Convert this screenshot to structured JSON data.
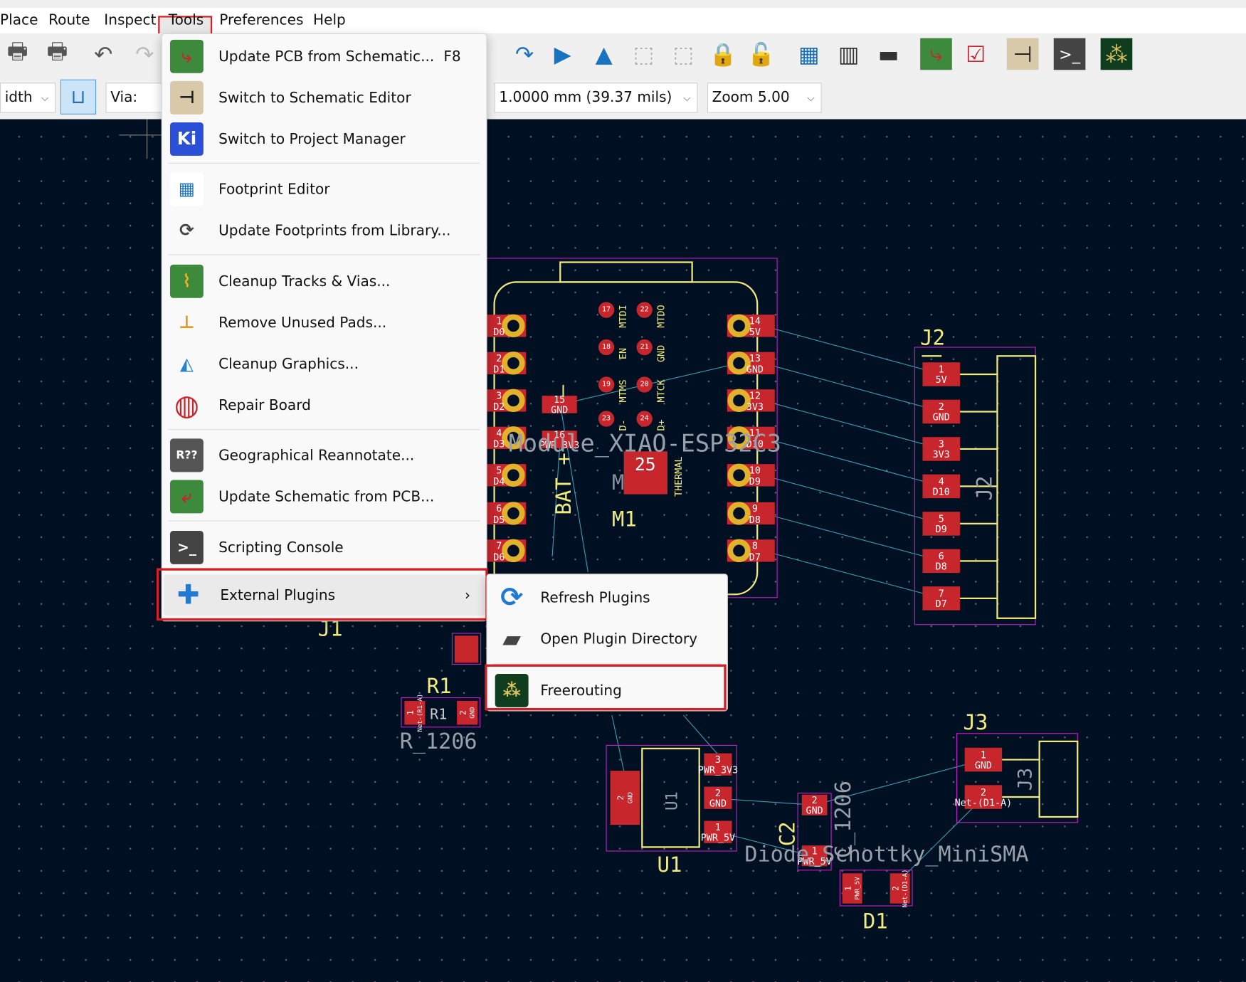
{
  "menubar": {
    "items": [
      "Place",
      "Route",
      "Inspect",
      "Tools",
      "Preferences",
      "Help"
    ],
    "active": "Tools"
  },
  "toolbar": {
    "icons": [
      "print-icon",
      "plot-icon",
      "undo-icon",
      "redo-icon",
      "search-icon",
      "refresh-icon",
      "flip-icon",
      "mirror-icon",
      "group-icon",
      "ungroup-icon",
      "lock-icon",
      "unlock-icon",
      "footprint-editor-icon",
      "footprint-browser-icon",
      "board-setup-icon",
      "update-pcb-icon",
      "drc-icon",
      "schematic-icon",
      "scripting-console-icon",
      "freerouting-icon"
    ],
    "track_width": "idth",
    "via_size": "Via: use",
    "grid": "1.0000 mm (39.37 mils)",
    "zoom": "Zoom 5.00"
  },
  "tools_menu": {
    "items": [
      {
        "label": "Update PCB from Schematic...",
        "shortcut": "F8",
        "icon": "update-pcb-icon"
      },
      {
        "label": "Switch to Schematic Editor",
        "icon": "schematic-editor-icon"
      },
      {
        "label": "Switch to Project Manager",
        "icon": "kicad-icon",
        "icon_text": "Ki"
      },
      {
        "label": "Footprint Editor",
        "icon": "footprint-editor-icon"
      },
      {
        "label": "Update Footprints from Library...",
        "icon": "refresh-icon"
      },
      {
        "label": "Cleanup Tracks & Vias...",
        "icon": "cleanup-tracks-icon"
      },
      {
        "label": "Remove Unused Pads...",
        "icon": "remove-pads-icon"
      },
      {
        "label": "Cleanup Graphics...",
        "icon": "cleanup-graphics-icon"
      },
      {
        "label": "Repair Board",
        "icon": "repair-icon"
      },
      {
        "label": "Geographical Reannotate...",
        "icon": "reannotate-icon",
        "icon_text": "R??"
      },
      {
        "label": "Update Schematic from PCB...",
        "icon": "update-schematic-icon"
      },
      {
        "label": "Scripting Console",
        "icon": "console-icon"
      },
      {
        "label": "External Plugins",
        "icon": "puzzle-icon",
        "has_submenu": true
      }
    ]
  },
  "plugins_menu": {
    "items": [
      {
        "label": "Refresh Plugins",
        "icon": "refresh-icon"
      },
      {
        "label": "Open Plugin Directory",
        "icon": "folder-icon"
      },
      {
        "label": "Freerouting",
        "icon": "freerouting-icon"
      }
    ]
  },
  "colors": {
    "canvas": "#001023",
    "pad": "#c8262d",
    "silk": "#f2eb7c",
    "courtyard": "#c21fc8",
    "ratsnest": "#3c9bb0",
    "highlight": "#d32027",
    "via_ring": "#e2b22c"
  },
  "pcb": {
    "module_value": "Module_XIAO-ESP32C3",
    "module_ref": "M1",
    "module_ref_fab": "M",
    "bat_label": "BAT +",
    "minus_label": "–",
    "left_pins": [
      [
        "1",
        "D0"
      ],
      [
        "2",
        "D1"
      ],
      [
        "3",
        "D2"
      ],
      [
        "4",
        "D3"
      ],
      [
        "5",
        "D4"
      ],
      [
        "6",
        "D5"
      ],
      [
        "7",
        "D6"
      ]
    ],
    "right_pins": [
      [
        "14",
        "5V"
      ],
      [
        "13",
        "GND"
      ],
      [
        "12",
        "3V3"
      ],
      [
        "11",
        "D10"
      ],
      [
        "10",
        "D9"
      ],
      [
        "9",
        "D8"
      ],
      [
        "8",
        "D7"
      ]
    ],
    "small_pads": [
      [
        "17",
        "MTDI"
      ],
      [
        "22",
        "MTDO"
      ],
      [
        "18",
        "EN"
      ],
      [
        "21",
        "GND"
      ],
      [
        "19",
        "MTMS"
      ],
      [
        "20",
        "MTCK"
      ],
      [
        "23",
        "D-"
      ],
      [
        "24",
        "D+"
      ]
    ],
    "smd_pads": [
      [
        "15",
        "GND"
      ],
      [
        "16",
        "PWR_3V3"
      ]
    ],
    "thermal_pad": "25",
    "thermal_label": "THERMAL",
    "j2": {
      "ref": "J2",
      "pins": [
        [
          "1",
          "5V"
        ],
        [
          "2",
          "GND"
        ],
        [
          "3",
          "3V3"
        ],
        [
          "4",
          "D10"
        ],
        [
          "5",
          "D9"
        ],
        [
          "6",
          "D8"
        ],
        [
          "7",
          "D7"
        ]
      ]
    },
    "j3": {
      "ref": "J3",
      "pins": [
        [
          "1",
          "GND"
        ],
        [
          "2",
          "Net-(D1-A)"
        ]
      ]
    },
    "j1": {
      "ref": "J1"
    },
    "r1": {
      "ref": "R1",
      "value": "R_1206",
      "pads": [
        [
          "1",
          "Net-(R1-A)"
        ],
        [
          "2",
          "GND"
        ]
      ]
    },
    "u1": {
      "ref": "U1",
      "pads": [
        [
          "2",
          "GND"
        ],
        [
          "3",
          "PWR_3V3"
        ],
        [
          "2",
          "GND"
        ],
        [
          "1",
          "PWR_5V"
        ]
      ]
    },
    "c2": {
      "ref": "C2",
      "value": "C_1206",
      "pads": [
        [
          "2",
          "GND"
        ],
        [
          "1",
          "PWR_5V"
        ]
      ]
    },
    "d1": {
      "ref": "D1",
      "value": "Diode_Schottky_MiniSMA",
      "pads": [
        [
          "1",
          "PWR_5V"
        ],
        [
          "2",
          "Net-(D1-A)"
        ]
      ]
    }
  }
}
